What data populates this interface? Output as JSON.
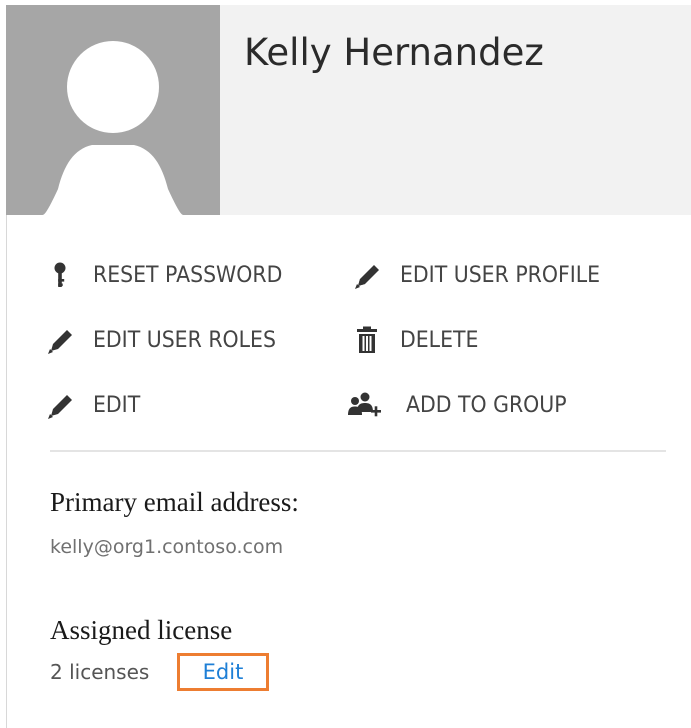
{
  "user": {
    "display_name": "Kelly Hernandez",
    "avatar_icon": "person-silhouette-icon"
  },
  "actions": [
    {
      "label": "RESET PASSWORD",
      "icon": "key-icon"
    },
    {
      "label": "EDIT USER PROFILE",
      "icon": "pencil-icon"
    },
    {
      "label": "EDIT USER ROLES",
      "icon": "pencil-icon"
    },
    {
      "label": "DELETE",
      "icon": "trash-icon"
    },
    {
      "label": "EDIT",
      "icon": "pencil-icon"
    },
    {
      "label": "ADD TO GROUP",
      "icon": "add-group-icon"
    }
  ],
  "primary_email": {
    "heading": "Primary email address:",
    "value": "kelly@org1.contoso.com"
  },
  "license": {
    "heading": "Assigned license",
    "count_text": "2 licenses",
    "edit_label": "Edit"
  },
  "colors": {
    "highlight": "#ed7d31",
    "link": "#1e7fd6",
    "avatar_bg": "#a6a6a6"
  }
}
